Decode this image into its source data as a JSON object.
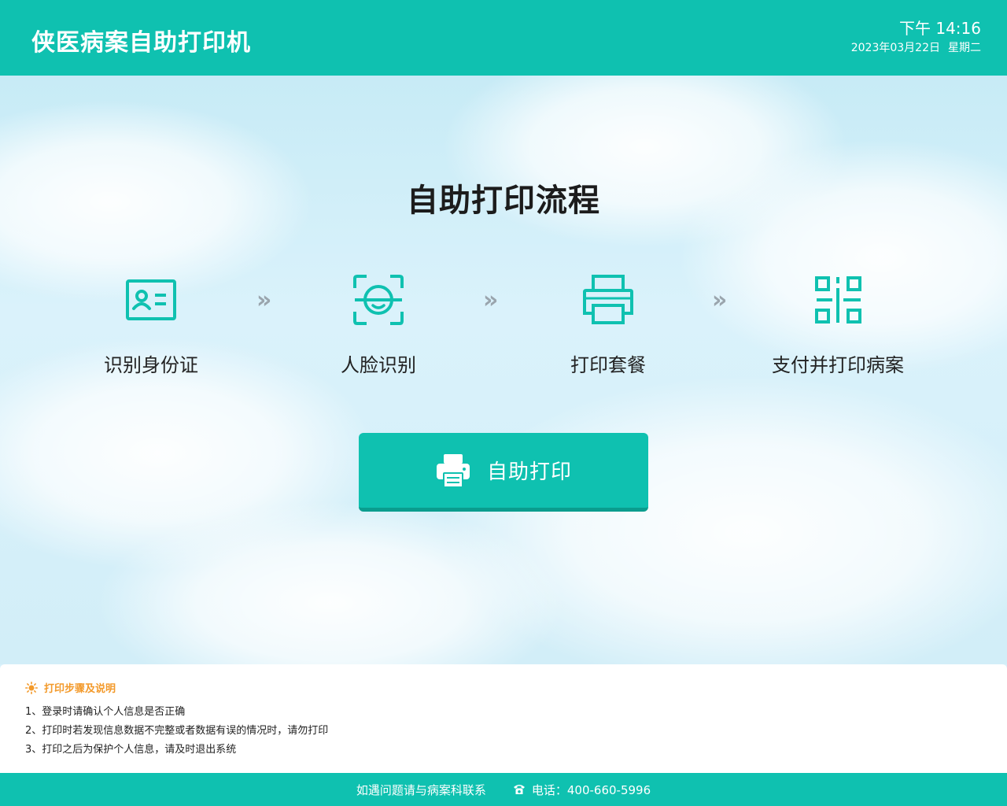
{
  "header": {
    "title": "侠医病案自助打印机",
    "time": "下午 14:16",
    "date": "2023年03月22日",
    "weekday": "星期二"
  },
  "main": {
    "flow_title": "自助打印流程",
    "steps": [
      {
        "label": "识别身份证",
        "icon": "id-card-icon"
      },
      {
        "label": "人脸识别",
        "icon": "face-scan-icon"
      },
      {
        "label": "打印套餐",
        "icon": "printer-icon"
      },
      {
        "label": "支付并打印病案",
        "icon": "qr-code-icon"
      }
    ],
    "arrow": "»",
    "print_button": {
      "label": "自助打印",
      "icon": "printer-icon"
    }
  },
  "notes": {
    "title": "打印步骤及说明",
    "items": [
      "1、登录时请确认个人信息是否正确",
      "2、打印时若发现信息数据不完整或者数据有误的情况时，请勿打印",
      "3、打印之后为保护个人信息，请及时退出系统"
    ]
  },
  "footer": {
    "contact": "如遇问题请与病案科联系",
    "phone": "电话：400-660-5996"
  },
  "colors": {
    "primary": "#0fc1b0",
    "primary_dark": "#0a9d8e",
    "notice": "#f39a2b",
    "arrow": "#9aa5ad"
  }
}
